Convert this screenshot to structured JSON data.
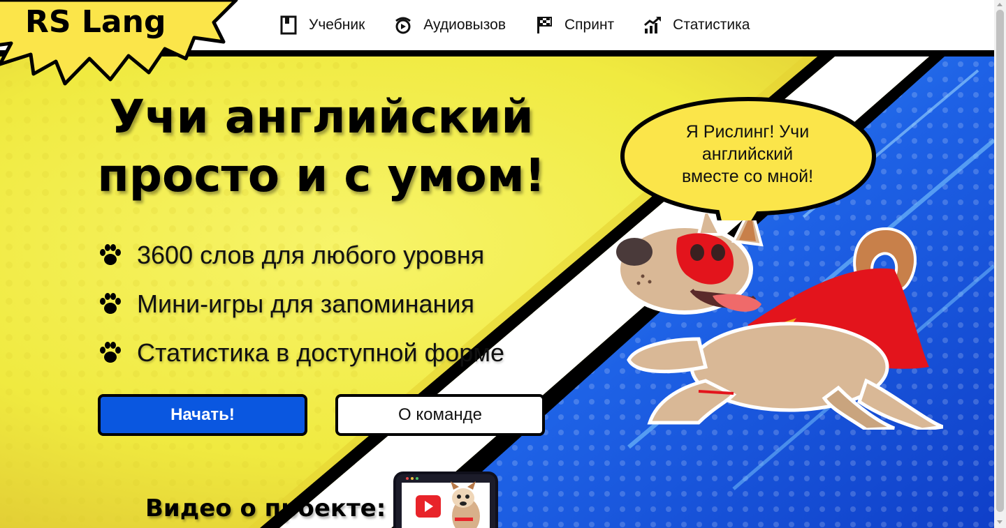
{
  "app": {
    "logo": "RS Lang"
  },
  "nav": {
    "items": [
      {
        "label": "Учебник",
        "icon": "book-icon"
      },
      {
        "label": "Аудиовызов",
        "icon": "audio-call-icon"
      },
      {
        "label": "Спринт",
        "icon": "flag-icon"
      },
      {
        "label": "Статистика",
        "icon": "chart-icon"
      }
    ]
  },
  "hero": {
    "title_line1": "Учи английский",
    "title_line2": "просто и с умом!",
    "features": [
      "3600 слов для любого уровня",
      "Мини-игры для запоминания",
      "Статистика в доступной форме"
    ],
    "start_label": "Начать!",
    "team_label": "О команде",
    "bubble_line1": "Я Рислинг! Учи",
    "bubble_line2": "английский",
    "bubble_line3": "вместе со мной!",
    "video_title": "Видео о проекте:"
  },
  "colors": {
    "yellow": "#f2ee4a",
    "blue": "#1e62e6",
    "primary_button": "#0a57e0",
    "cape_red": "#e3141c",
    "bubble_yellow": "#fbe54a"
  }
}
